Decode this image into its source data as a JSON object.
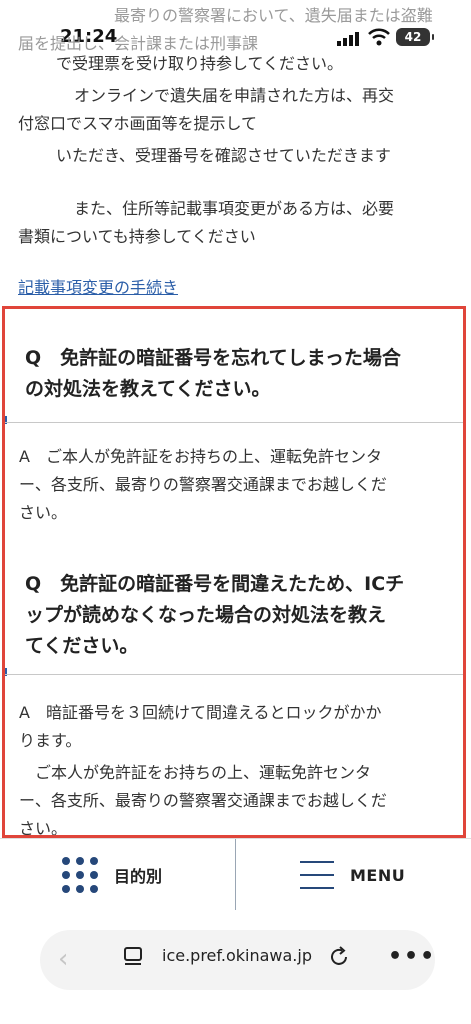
{
  "status_bar": {
    "time": "21:24",
    "battery": "42"
  },
  "content": {
    "lines": [
      "最寄りの警察署において、遺失届または盗難",
      "届を提出し、会計課または刑事課",
      "で受理票を受け取り持参してください。",
      "オンラインで遺失届を申請された方は、再交",
      "付窓口でスマホ画面等を提示して",
      "いただき、受理番号を確認させていただきます",
      "また、住所等記載事項変更がある方は、必要",
      "書類についても持参してください"
    ],
    "link_text": "記載事項変更の手続き"
  },
  "faq": [
    {
      "question_lines": [
        "Q　免許証の暗証番号を忘れてしまった場合",
        "の対処法を教えてください。"
      ],
      "answer_lines": [
        "A　ご本人が免許証をお持ちの上、運転免許センタ",
        "ー、各支所、最寄りの警察署交通課までお越しくだ",
        "さい。"
      ]
    },
    {
      "question_lines": [
        "Q　免許証の暗証番号を間違えたため、ICチ",
        "ップが読めなくなった場合の対処法を教え",
        "てください。"
      ],
      "answer_lines": [
        "A　暗証番号を３回続けて間違えるとロックがかか",
        "ります。",
        "　ご本人が免許証をお持ちの上、運転免許センタ",
        "ー、各支所、最寄りの警察署交通課までお越しくだ",
        "さい。"
      ]
    }
  ],
  "bottom_nav": {
    "purpose_label": "目的別",
    "menu_label": "MENU"
  },
  "browser": {
    "url": "ice.pref.okinawa.jp"
  },
  "colors": {
    "accent": "#26487a",
    "link": "#2b5ea8",
    "highlight": "#e0453a"
  }
}
